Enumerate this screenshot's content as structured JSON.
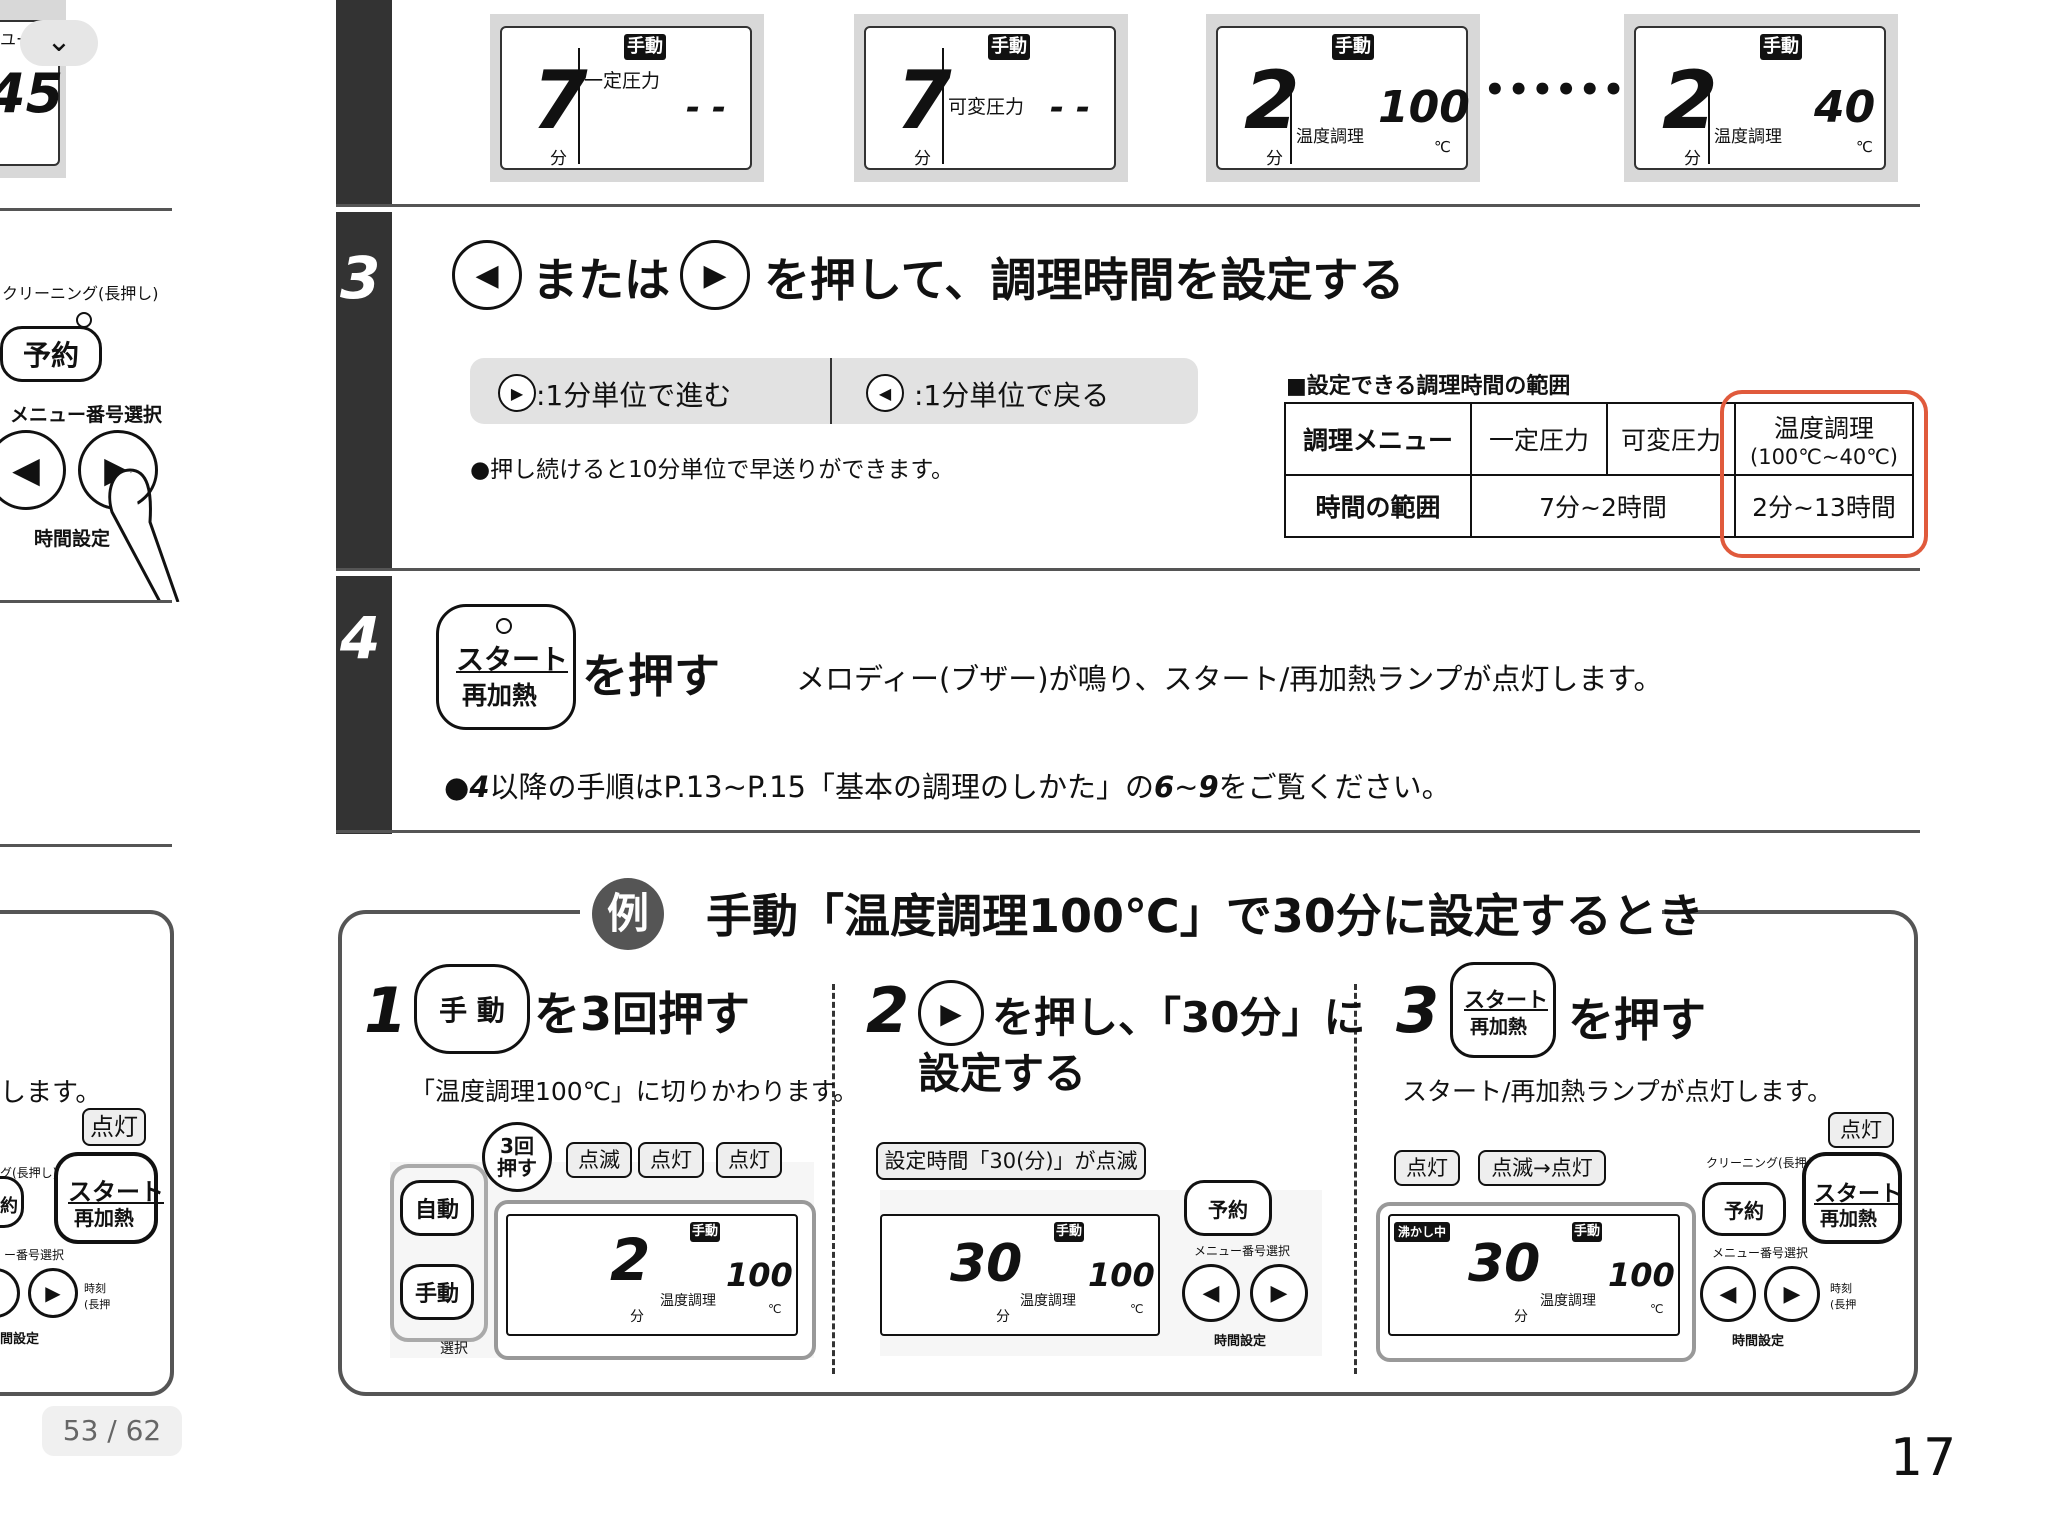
{
  "left_panel": {
    "lcd_label": "ユー",
    "lcd_digits": "45",
    "cleaning_label": "クリーニング(長押し)",
    "reserve_button": "予約",
    "menu_select_label": "メニュー番号選択",
    "time_setting_label": "時間設定",
    "partial_text": "します。",
    "lit_label": "点灯",
    "start_button_top": "スタート",
    "start_button_bottom": "再加熱",
    "bottom_cleaning": "グ(長押し)",
    "bottom_reserve": "約",
    "bottom_menu": "ー番号選択",
    "bottom_time_setting": "間設定",
    "bottom_clock": "時刻",
    "bottom_long": "(長押"
  },
  "collapse_button": "chevron-down-icon",
  "page_indicator": "53 / 62",
  "page_number": "17",
  "top_displays": [
    {
      "mode": "手動",
      "digit": "7",
      "unit": "分",
      "menu": "一定圧力",
      "value": "- -",
      "deg": ""
    },
    {
      "mode": "手動",
      "digit": "7",
      "unit": "分",
      "menu": "可変圧力",
      "value": "- -",
      "deg": ""
    },
    {
      "mode": "手動",
      "digit": "2",
      "unit": "分",
      "menu": "温度調理",
      "value": "100",
      "deg": "℃"
    },
    {
      "mode": "手動",
      "digit": "2",
      "unit": "分",
      "menu": "温度調理",
      "value": "40",
      "deg": "℃"
    }
  ],
  "step3": {
    "number": "3",
    "heading_mid": "または",
    "heading_end": "を押して、調理時間を設定する",
    "forward": ":1分単位で進む",
    "back": ":1分単位で戻る",
    "note": "●押し続けると10分単位で早送りができます。",
    "table_title": "■設定できる調理時間の範囲",
    "table": {
      "header": [
        "調理メニュー",
        "一定圧力",
        "可変圧力",
        "温度調理",
        "(100℃~40℃)"
      ],
      "row_label": "時間の範囲",
      "range_pressure": "7分~2時間",
      "range_temp": "2分~13時間"
    }
  },
  "step4": {
    "number": "4",
    "button_top": "スタート",
    "button_bottom": "再加熱",
    "heading": "を押す",
    "desc": "メロディー(ブザー)が鳴り、スタート/再加熱ランプが点灯します。",
    "note_bullet": "●",
    "note_num1": "4",
    "note_mid": "以降の手順はP.13~P.15「基本の調理のしかた」の",
    "note_num2": "6",
    "note_tilde": "~",
    "note_num3": "9",
    "note_end": "をご覧ください。"
  },
  "example": {
    "badge": "例",
    "title": "手動「温度調理100℃」で30分に設定するとき",
    "steps": [
      {
        "num": "1",
        "button": "手 動",
        "heading": "を3回押す",
        "desc": "「温度調理100℃」に切りかわります。",
        "auto_button": "自動",
        "manual_button": "手動",
        "select_label": "選択",
        "bubble": "3回\n押す",
        "callouts": [
          "点滅",
          "点灯",
          "点灯"
        ],
        "lcd": {
          "mode": "手動",
          "digit": "2",
          "unit": "分",
          "menu": "温度調理",
          "value": "100",
          "deg": "℃"
        }
      },
      {
        "num": "2",
        "heading1": "を押し、「30分」に",
        "heading2": "設定する",
        "callout": "設定時間「30(分)」が点滅",
        "reserve": "予約",
        "menu_label": "メニュー番号選択",
        "time_label": "時間設定",
        "lcd": {
          "mode": "手動",
          "digit": "30",
          "unit": "分",
          "menu": "温度調理",
          "value": "100",
          "deg": "℃"
        }
      },
      {
        "num": "3",
        "button_top": "スタート",
        "button_bottom": "再加熱",
        "heading": "を押す",
        "desc": "スタート/再加熱ランプが点灯します。",
        "callouts": [
          "点灯",
          "点滅→点灯",
          "点灯"
        ],
        "boiling": "沸かし中",
        "cleaning": "クリーニング(長押し)",
        "reserve": "予約",
        "menu_label": "メニュー番号選択",
        "time_label": "時間設定",
        "clock": "時刻",
        "long_press": "(長押",
        "lcd": {
          "mode": "手動",
          "digit": "30",
          "unit": "分",
          "menu": "温度調理",
          "value": "100",
          "deg": "℃"
        }
      }
    ]
  }
}
